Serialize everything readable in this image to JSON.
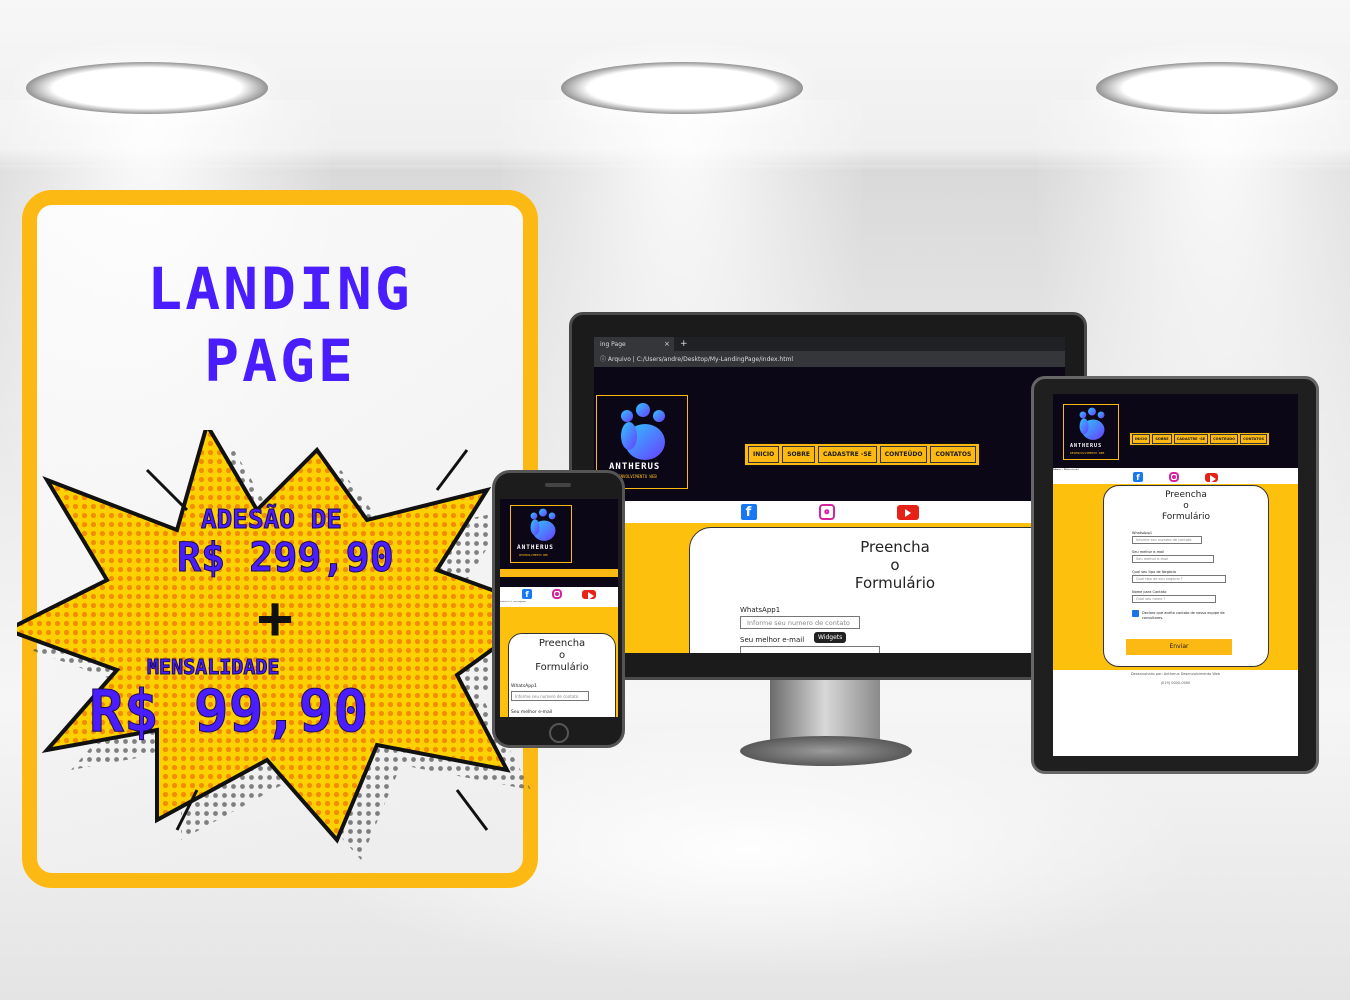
{
  "promo": {
    "title_line1": "LANDING",
    "title_line2": "PAGE",
    "adhesion_label": "ADESÃO DE",
    "adhesion_price": "R$ 299,90",
    "plus": "+",
    "monthly_label": "MENSALIDADE",
    "monthly_price": "R$ 99,90",
    "accent_color": "#4a1dff",
    "frame_color": "#fdb913"
  },
  "browser": {
    "tab_title": "ing Page",
    "tab_close": "×",
    "tab_add": "+",
    "address": "ⓘ Arquivo  |  C:/Users/andre/Desktop/My-LandingPage/index.html"
  },
  "site": {
    "brand": "ANTHERUS",
    "brand_sub": "DESENVOLVIMENTO WEB",
    "nav": [
      "INICIO",
      "SOBRE",
      "CADASTRE -SE",
      "CONTEÚDO",
      "CONTATOS"
    ],
    "social_icons": [
      "facebook-icon",
      "instagram-icon",
      "youtube-icon"
    ],
    "form_title": [
      "Preencha",
      "o",
      "Formulário"
    ],
    "fields": [
      {
        "label": "WhatsApp1",
        "placeholder": "Informe seu numero de contato"
      },
      {
        "label": "Seu melhor e-mail",
        "placeholder": "Seu melhor e-mail"
      },
      {
        "label": "Qual seu tipo de Negócio",
        "placeholder": "Qual tipo do seu negócio ?"
      },
      {
        "label": "Nome para Contato",
        "placeholder": "Qual seu nome ?"
      }
    ],
    "tooltip": "Widgets",
    "checkbox_text": "Declaro que aceito contato de nossa equipe de consultores.",
    "send_label": "Enviar",
    "footer": "Desenvolvido por: Antherus Desenvolvimento Web",
    "phone_number": "(019) 0000-0000",
    "menu_label": "Menu Principal",
    "phone_field_label": "WhatsApp1",
    "phone_field2_label": "Seu melhor e-mail"
  }
}
